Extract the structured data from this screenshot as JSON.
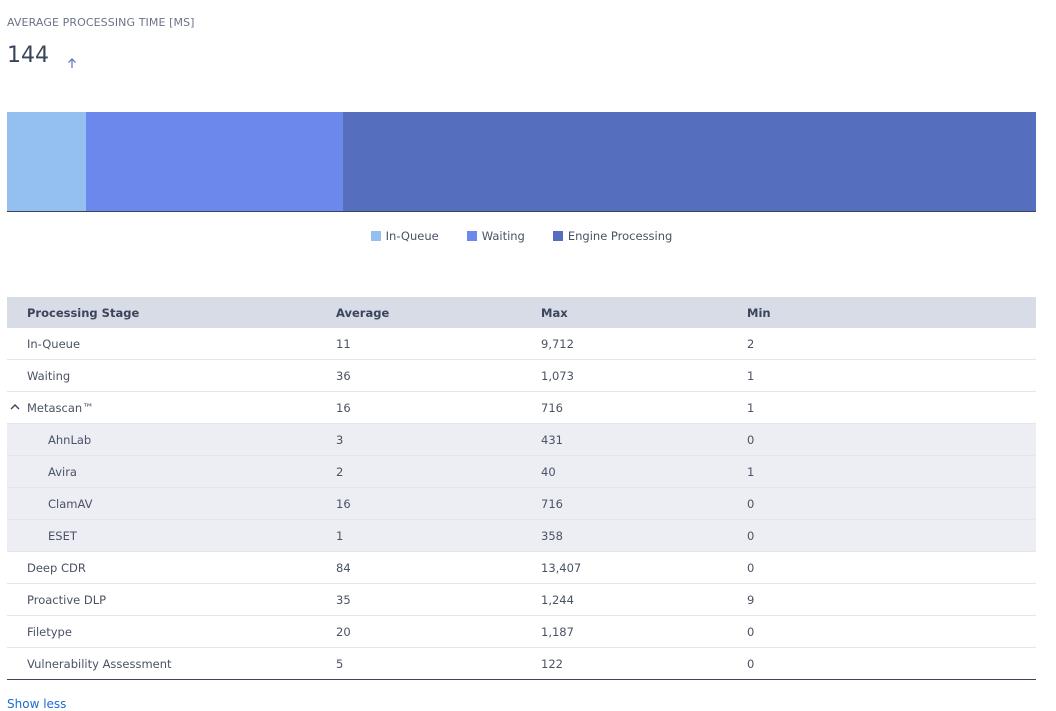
{
  "header": {
    "title": "AVERAGE PROCESSING TIME [MS]",
    "value": "144",
    "trend_icon": "arrow-up-icon"
  },
  "breakdown_bar": {
    "segments": [
      {
        "name": "In-Queue",
        "value": 11,
        "color": "#94bff1"
      },
      {
        "name": "Waiting",
        "value": 36,
        "color": "#6b88ec"
      },
      {
        "name": "Engine Processing",
        "value": 97,
        "color": "#566ebe"
      }
    ]
  },
  "legend": [
    {
      "label": "In-Queue",
      "color": "#94bff1"
    },
    {
      "label": "Waiting",
      "color": "#6b88ec"
    },
    {
      "label": "Engine Processing",
      "color": "#566ebe"
    }
  ],
  "table": {
    "columns": [
      "Processing Stage",
      "Average",
      "Max",
      "Min"
    ],
    "rows": [
      {
        "stage": "In-Queue",
        "average": "11",
        "max": "9,712",
        "min": "2"
      },
      {
        "stage": "Waiting",
        "average": "36",
        "max": "1,073",
        "min": "1"
      },
      {
        "stage": "Metascan™",
        "average": "16",
        "max": "716",
        "min": "1",
        "expandable": true
      },
      {
        "stage": "AhnLab",
        "average": "3",
        "max": "431",
        "min": "0",
        "sub": true
      },
      {
        "stage": "Avira",
        "average": "2",
        "max": "40",
        "min": "1",
        "sub": true
      },
      {
        "stage": "ClamAV",
        "average": "16",
        "max": "716",
        "min": "0",
        "sub": true
      },
      {
        "stage": "ESET",
        "average": "1",
        "max": "358",
        "min": "0",
        "sub": true
      },
      {
        "stage": "Deep CDR",
        "average": "84",
        "max": "13,407",
        "min": "0"
      },
      {
        "stage": "Proactive DLP",
        "average": "35",
        "max": "1,244",
        "min": "9"
      },
      {
        "stage": "Filetype",
        "average": "20",
        "max": "1,187",
        "min": "0"
      },
      {
        "stage": "Vulnerability Assessment",
        "average": "5",
        "max": "122",
        "min": "0"
      }
    ]
  },
  "show_less_label": "Show less"
}
